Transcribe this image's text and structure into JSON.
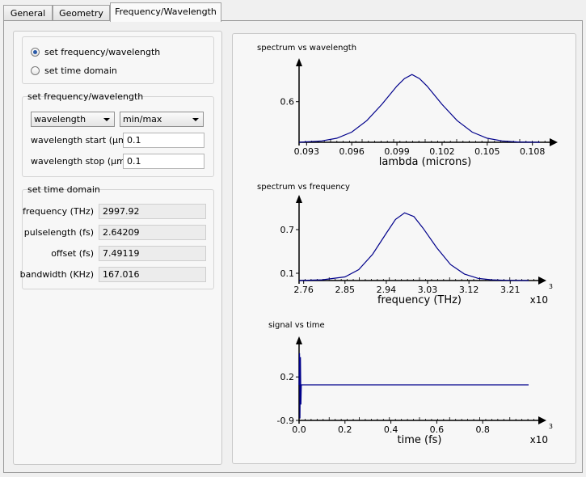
{
  "tabs": [
    {
      "label": "General",
      "active": false
    },
    {
      "label": "Geometry",
      "active": false
    },
    {
      "label": "Frequency/Wavelength",
      "active": true
    }
  ],
  "mode": {
    "opt_freq": "set frequency/wavelength",
    "opt_time": "set time domain",
    "selected": "set frequency/wavelength"
  },
  "freq_group": {
    "title": "set frequency/wavelength",
    "type_value": "wavelength",
    "range_value": "min/max",
    "start_label": "wavelength start (µm)",
    "start_value": "0.1",
    "stop_label": "wavelength stop (µm)",
    "stop_value": "0.1"
  },
  "time_group": {
    "title": "set time domain",
    "rows": [
      {
        "label": "frequency (THz)",
        "value": "2997.92"
      },
      {
        "label": "pulselength (fs)",
        "value": "2.64209"
      },
      {
        "label": "offset (fs)",
        "value": "7.49119"
      },
      {
        "label": "bandwidth (KHz)",
        "value": "167.016"
      }
    ]
  },
  "colors": {
    "curve": "#00008b",
    "axis": "#000000"
  },
  "chart_data": [
    {
      "type": "line",
      "title": "spectrum vs wavelength",
      "xlabel": "lambda (microns)",
      "ylabel": "",
      "x_ticks": [
        "0.093",
        "0.096",
        "0.099",
        "0.102",
        "0.105",
        "0.108"
      ],
      "x_tick_values": [
        0.093,
        0.096,
        0.099,
        0.102,
        0.105,
        0.108
      ],
      "y_ticks": [
        "0.6"
      ],
      "y_tick_values": [
        0.6
      ],
      "xlim": [
        0.0925,
        0.1085
      ],
      "ylim": [
        0.0,
        1.05
      ],
      "x_multiplier": "",
      "series": [
        {
          "x": [
            0.0925,
            0.094,
            0.095,
            0.096,
            0.097,
            0.098,
            0.099,
            0.0995,
            0.1,
            0.1005,
            0.101,
            0.102,
            0.103,
            0.104,
            0.105,
            0.106,
            0.107,
            0.1085
          ],
          "y": [
            0.0,
            0.02,
            0.06,
            0.15,
            0.32,
            0.56,
            0.83,
            0.94,
            1.0,
            0.94,
            0.83,
            0.56,
            0.32,
            0.15,
            0.06,
            0.02,
            0.005,
            0.0
          ]
        }
      ]
    },
    {
      "type": "line",
      "title": "spectrum vs frequency",
      "xlabel": "frequency (THz)",
      "ylabel": "",
      "x_ticks": [
        "2.76",
        "2.85",
        "2.94",
        "3.03",
        "3.12",
        "3.21"
      ],
      "x_tick_values": [
        2.76,
        2.85,
        2.94,
        3.03,
        3.12,
        3.21
      ],
      "y_ticks": [
        "0.7",
        "0.1"
      ],
      "y_tick_values": [
        0.7,
        0.1
      ],
      "xlim": [
        2.75,
        3.25
      ],
      "ylim": [
        0.0,
        1.0
      ],
      "x_multiplier": "x10",
      "x_multiplier_exp": "3",
      "series": [
        {
          "x": [
            2.75,
            2.8,
            2.85,
            2.88,
            2.91,
            2.94,
            2.96,
            2.98,
            3.0,
            3.02,
            3.05,
            3.08,
            3.11,
            3.14,
            3.17,
            3.2,
            3.25
          ],
          "y": [
            0.0,
            0.01,
            0.05,
            0.15,
            0.36,
            0.65,
            0.84,
            0.93,
            0.88,
            0.72,
            0.45,
            0.22,
            0.09,
            0.03,
            0.01,
            0.003,
            0.0
          ]
        }
      ]
    },
    {
      "type": "line",
      "title": "signal vs time",
      "xlabel": "time (fs)",
      "ylabel": "",
      "x_ticks": [
        "0.0",
        "0.2",
        "0.4",
        "0.6",
        "0.8"
      ],
      "x_tick_values": [
        0.0,
        0.2,
        0.4,
        0.6,
        0.8
      ],
      "y_ticks": [
        "0.2",
        "-0.9"
      ],
      "y_tick_values": [
        0.2,
        -0.9
      ],
      "xlim": [
        0.0,
        1.0
      ],
      "ylim": [
        -0.9,
        0.9
      ],
      "x_multiplier": "x10",
      "x_multiplier_exp": "3",
      "series": [
        {
          "x": [
            0.0,
            0.002,
            0.004,
            0.006,
            0.008,
            0.01,
            1.0
          ],
          "y": [
            0.0,
            0.8,
            -0.85,
            0.7,
            -0.5,
            0.0,
            0.0
          ]
        }
      ]
    }
  ]
}
